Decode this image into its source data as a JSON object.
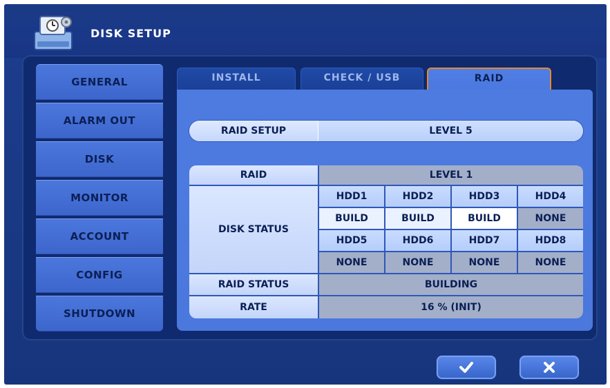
{
  "window": {
    "title": "DISK SETUP"
  },
  "sidebar": {
    "items": [
      {
        "label": "GENERAL"
      },
      {
        "label": "ALARM OUT"
      },
      {
        "label": "DISK"
      },
      {
        "label": "MONITOR"
      },
      {
        "label": "ACCOUNT"
      },
      {
        "label": "CONFIG"
      },
      {
        "label": "SHUTDOWN"
      }
    ]
  },
  "tabs": [
    {
      "label": "INSTALL",
      "active": false
    },
    {
      "label": "CHECK / USB",
      "active": false
    },
    {
      "label": "RAID",
      "active": true
    }
  ],
  "raid_setup": {
    "label": "RAID SETUP",
    "value": "LEVEL 5"
  },
  "raid_table": {
    "raid_label": "RAID",
    "raid_value": "LEVEL 1",
    "disk_status_label": "DISK STATUS",
    "hdd_row1": [
      "HDD1",
      "HDD2",
      "HDD3",
      "HDD4"
    ],
    "status_row1": [
      "BUILD",
      "BUILD",
      "BUILD",
      "NONE"
    ],
    "hdd_row2": [
      "HDD5",
      "HDD6",
      "HDD7",
      "HDD8"
    ],
    "status_row2": [
      "NONE",
      "NONE",
      "NONE",
      "NONE"
    ],
    "raid_status_label": "RAID STATUS",
    "raid_status_value": "BUILDING",
    "rate_label": "RATE",
    "rate_value": "16 % (INIT)"
  },
  "buttons": {
    "ok_icon": "check-icon",
    "cancel_icon": "close-icon"
  },
  "colors": {
    "active_tab_border": "#e8872f",
    "accent": "#4b78dc"
  }
}
